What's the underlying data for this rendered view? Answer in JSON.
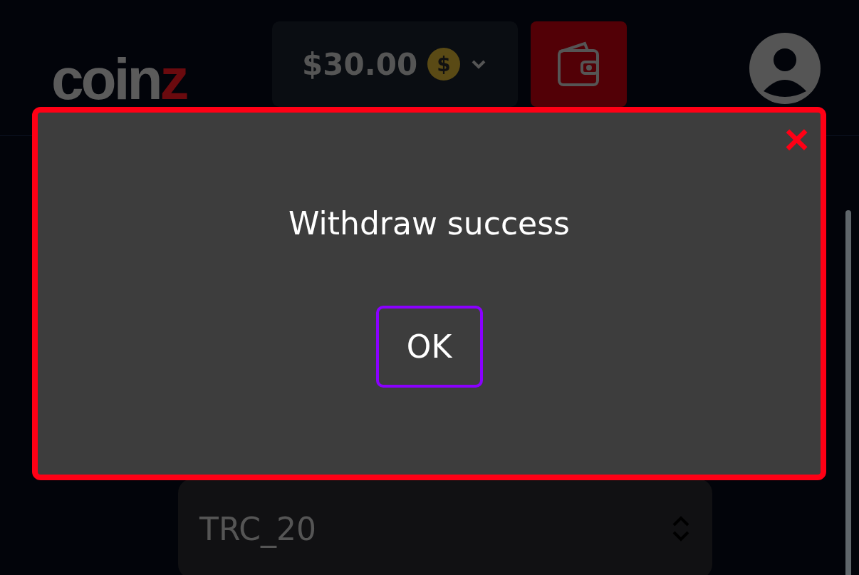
{
  "header": {
    "logo": {
      "text": "coin",
      "accent": "z"
    },
    "balance": {
      "amount": "$30.00",
      "coin_symbol": "$"
    }
  },
  "network_select": {
    "value": "TRC_20"
  },
  "dialog": {
    "message": "Withdraw success",
    "button": "OK",
    "close": "×"
  }
}
